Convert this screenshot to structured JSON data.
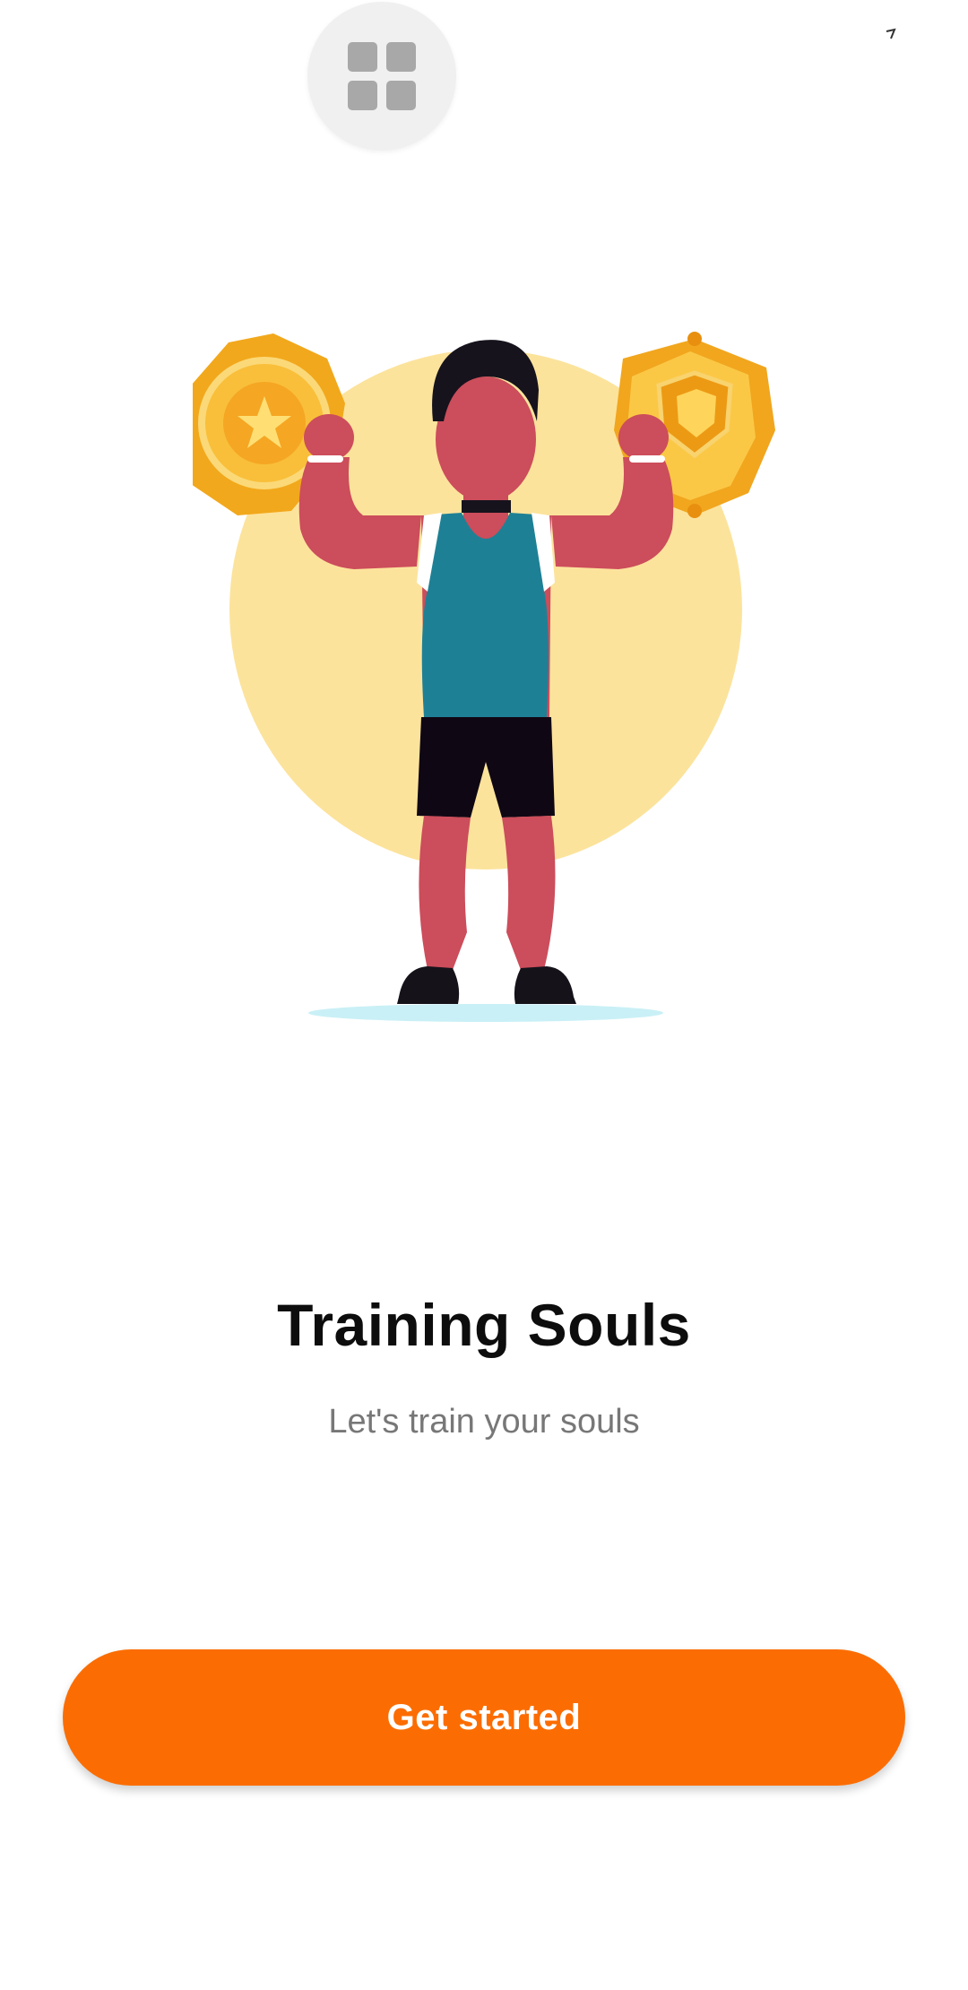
{
  "app": {
    "title": "Training Souls",
    "subtitle": "Let's train your souls"
  },
  "actions": {
    "get_started_label": "Get started"
  },
  "icons": {
    "overlay_toggle": "grid-icon",
    "status": "arrow-icon",
    "hero": "athlete-with-medals-illustration"
  },
  "colors": {
    "accent": "#fb6d02",
    "title": "#0d0d0d",
    "subtitle": "#777777",
    "hero_circle": "#fce39c",
    "medal_gold": "#f6b52b"
  }
}
